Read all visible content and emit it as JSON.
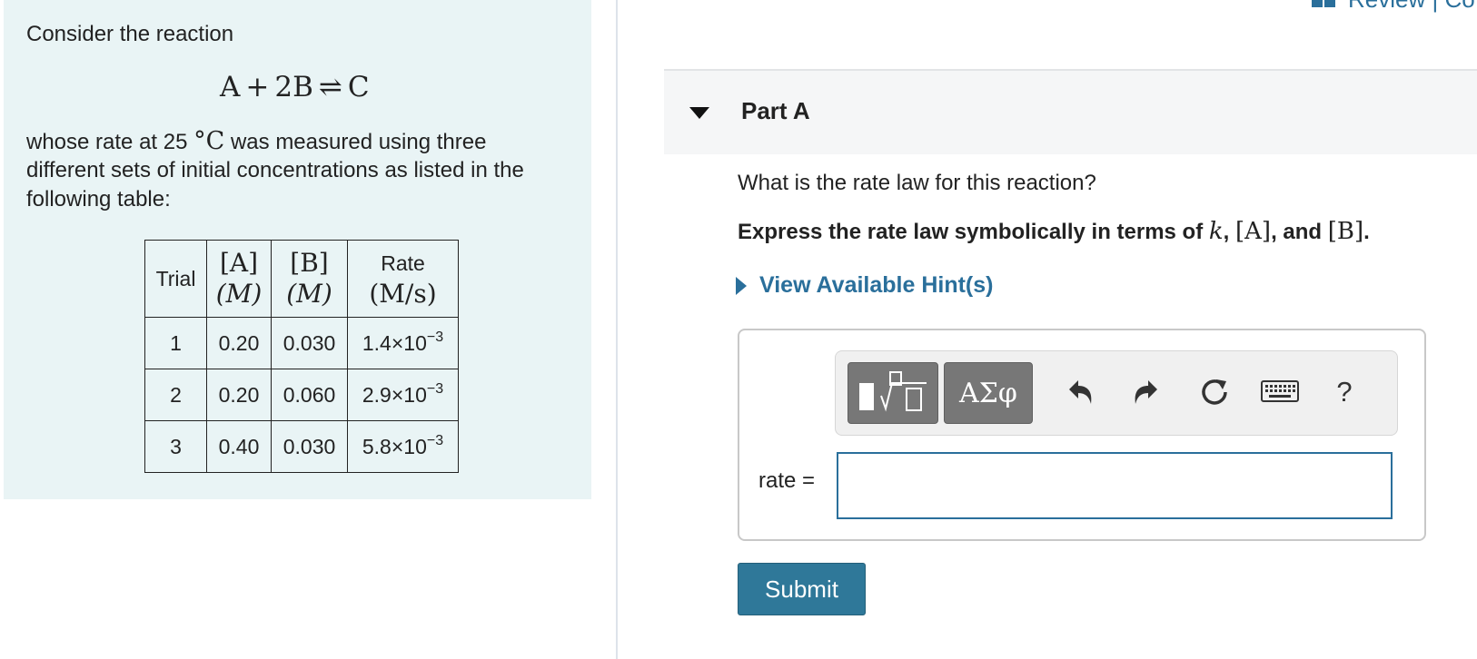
{
  "problem": {
    "intro": "Consider the reaction",
    "equation": {
      "lhs_a": "A",
      "plus": "+",
      "lhs_b": "2B",
      "arrow": "⇌",
      "rhs": "C"
    },
    "description_before_temp": "whose rate at 25 ",
    "temp_unit": "°C",
    "description_after_temp": " was measured using three",
    "description_line2": "different sets of initial concentrations as listed in the",
    "description_line3": "following table:"
  },
  "table": {
    "headers": {
      "trial": "Trial",
      "a_top": "[A]",
      "a_bottom": "(M)",
      "b_top": "[B]",
      "b_bottom": "(M)",
      "rate_top": "Rate",
      "rate_bottom": "(M/s)"
    },
    "rows": [
      {
        "trial": "1",
        "a": "0.20",
        "b": "0.030",
        "rate_base": "1.4×10",
        "rate_exp": "−3"
      },
      {
        "trial": "2",
        "a": "0.20",
        "b": "0.060",
        "rate_base": "2.9×10",
        "rate_exp": "−3"
      },
      {
        "trial": "3",
        "a": "0.40",
        "b": "0.030",
        "rate_base": "5.8×10",
        "rate_exp": "−3"
      }
    ]
  },
  "header_link": {
    "text": "Review | Co",
    "icon": "book-icon"
  },
  "part": {
    "title": "Part A",
    "caret_icon": "caret-down-icon"
  },
  "question": "What is the rate law for this reaction?",
  "instruction": {
    "prefix": "Express the rate law symbolically in terms of ",
    "k": "k",
    "comma1": ", ",
    "a": "[A]",
    "comma2": ", and ",
    "b": "[B]",
    "suffix": "."
  },
  "hint": {
    "label": "View Available Hint(s)",
    "icon": "caret-right-icon"
  },
  "toolbar": {
    "templates_icon": "templates-icon",
    "symbols_label": "ΑΣφ",
    "undo_icon": "undo-icon",
    "redo_icon": "redo-icon",
    "reset_icon": "reset-icon",
    "keyboard_icon": "keyboard-icon",
    "help_label": "?"
  },
  "answer": {
    "label": "rate =",
    "value": ""
  },
  "submit_label": "Submit",
  "colors": {
    "accent": "#2a6f9b",
    "panel_bg": "#e9f4f5",
    "submit_bg": "#2f7899"
  }
}
